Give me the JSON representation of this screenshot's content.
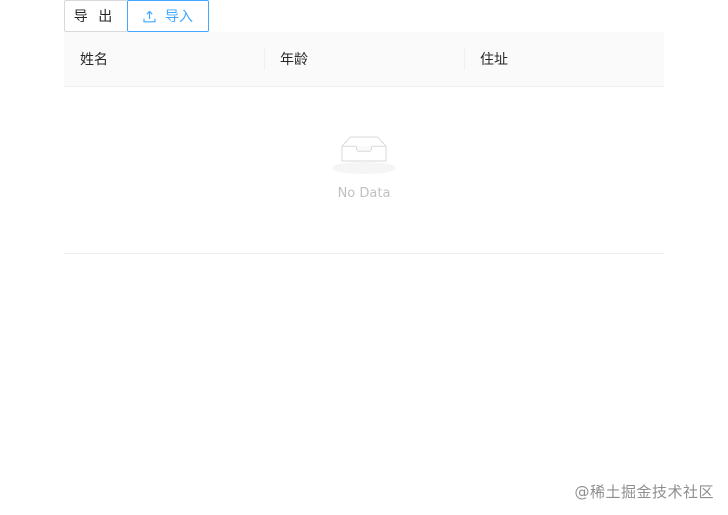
{
  "toolbar": {
    "export_label": "导 出",
    "import_label": "导入",
    "import_icon": "upload-icon"
  },
  "table": {
    "columns": [
      "姓名",
      "年龄",
      "住址"
    ],
    "rows": [],
    "empty_text": "No Data",
    "empty_icon": "empty-inbox-icon"
  },
  "watermark": "@稀土掘金技术社区",
  "colors": {
    "primary": "#40a9ff",
    "border": "#d9d9d9",
    "header_bg": "#fafafa",
    "divider": "#f0f0f0"
  }
}
